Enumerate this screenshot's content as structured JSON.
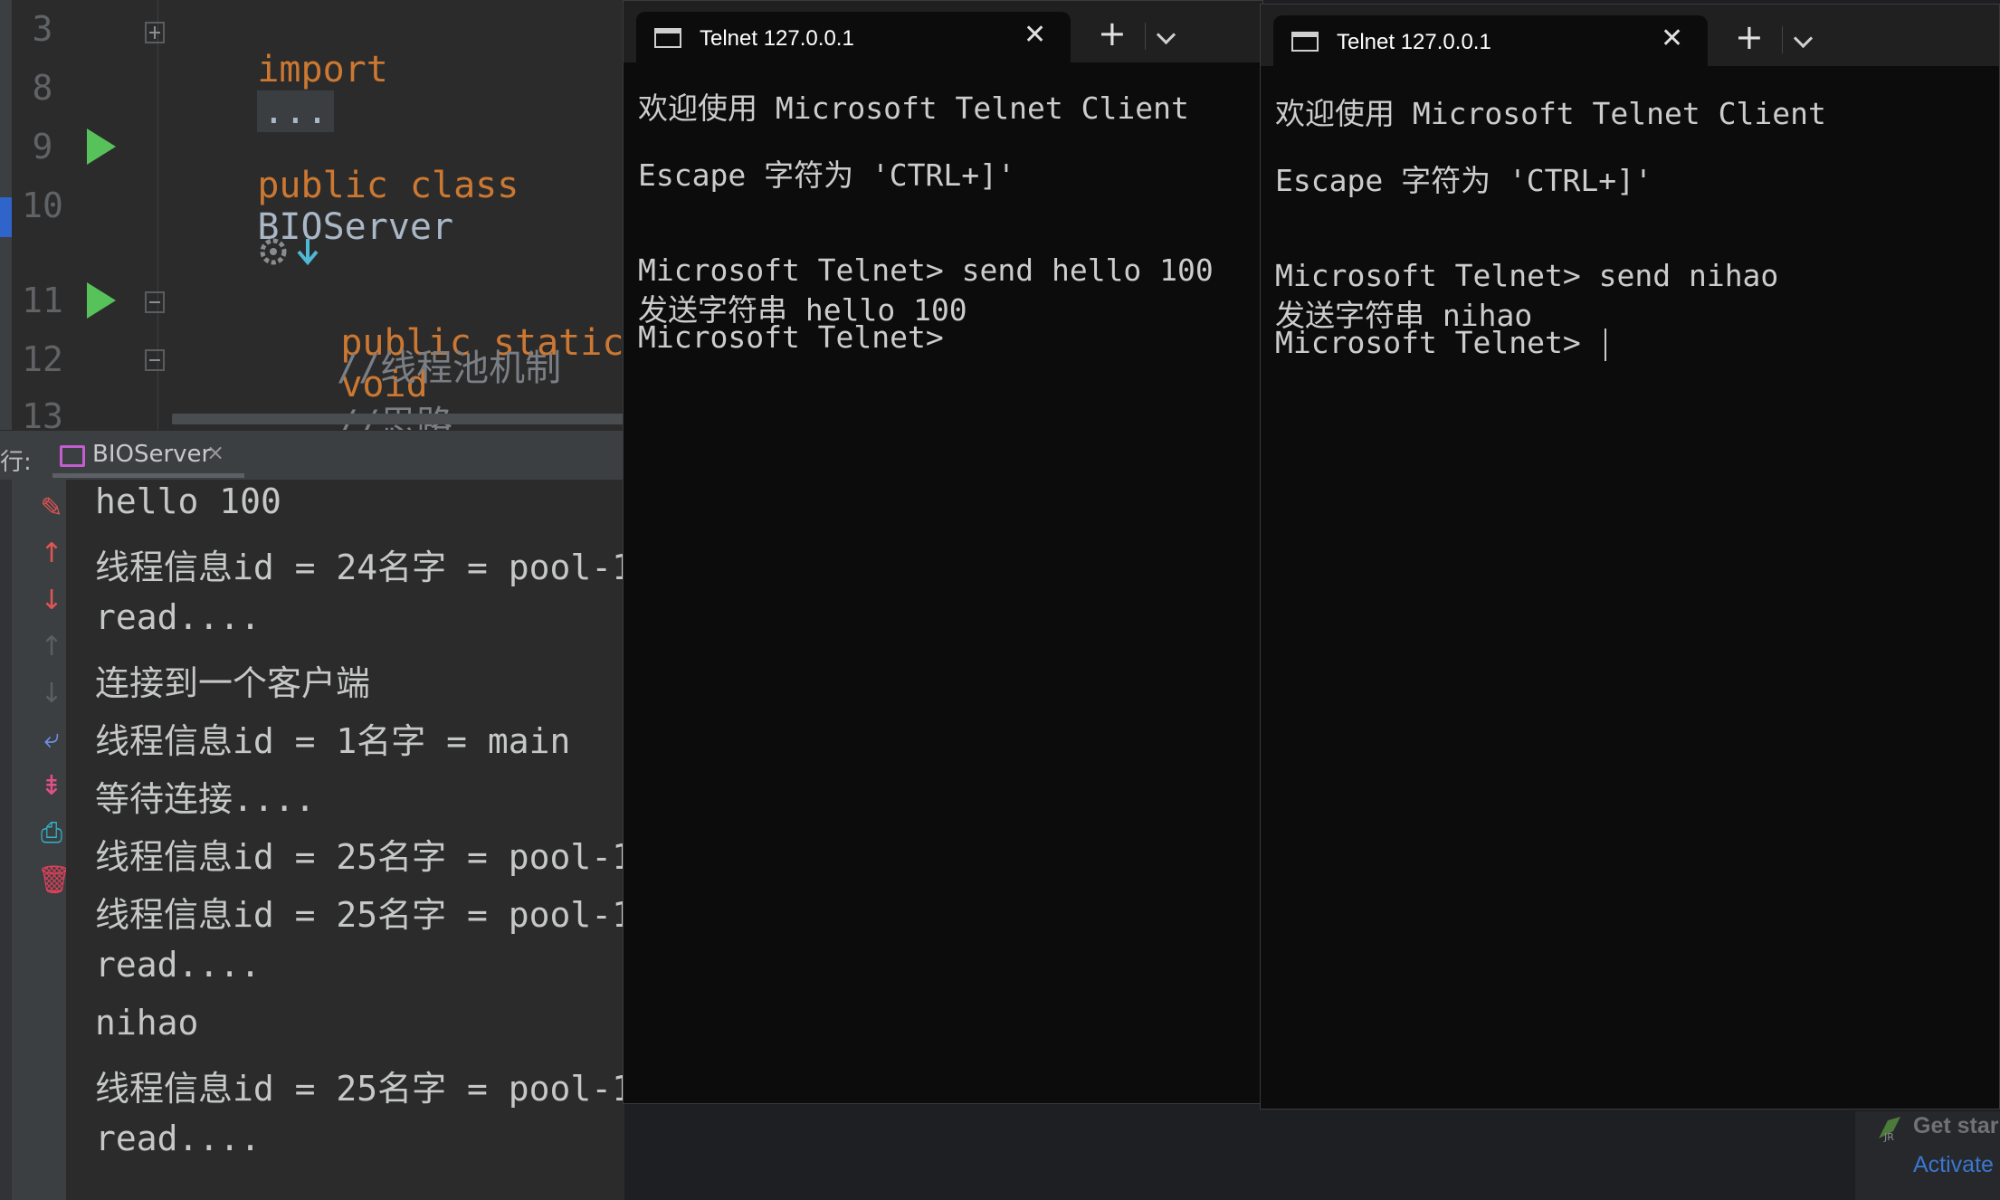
{
  "editor": {
    "line_numbers": [
      "3",
      "8",
      "9",
      "10",
      "11",
      "12",
      "13"
    ],
    "code": {
      "import_kw": "import",
      "import_dots": "...",
      "class_kw": "public class",
      "class_name": "BIOServer",
      "method_kw": "public static",
      "method_tail": "void",
      "comment1": "//线程池机制",
      "comment2": "//思路"
    }
  },
  "run_panel": {
    "label": "行:",
    "tab_label": "BIOServer",
    "tab_close": "×",
    "console_lines": [
      "hello 100",
      "线程信息id = 24名字 = pool-1",
      "read....",
      "连接到一个客户端",
      "线程信息id = 1名字 = main",
      "等待连接....",
      "线程信息id = 25名字 = pool-1",
      "线程信息id = 25名字 = pool-1",
      "read....",
      "nihao",
      "线程信息id = 25名字 = pool-1",
      "read...."
    ],
    "toolbar_icons": [
      "edit-icon",
      "scroll-up-icon",
      "scroll-down-icon",
      "up-arrow-icon",
      "down-arrow-icon",
      "soft-wrap-icon",
      "scroll-to-end-icon",
      "print-icon",
      "trash-icon"
    ]
  },
  "telnet_left": {
    "tab_title": "Telnet 127.0.0.1",
    "close": "✕",
    "new_tab": "+",
    "lines": [
      "欢迎使用 Microsoft Telnet Client",
      "Escape 字符为 'CTRL+]'",
      "Microsoft Telnet> send hello 100",
      "发送字符串 hello 100",
      "Microsoft Telnet>"
    ]
  },
  "telnet_right": {
    "tab_title": "Telnet 127.0.0.1",
    "close": "✕",
    "new_tab": "+",
    "lines": [
      "欢迎使用 Microsoft Telnet Client",
      "Escape 字符为 'CTRL+]'",
      "Microsoft Telnet> send nihao",
      "发送字符串 nihao",
      "Microsoft Telnet> "
    ]
  },
  "watermark": {
    "line1": "Get star",
    "line2": "Activate"
  },
  "colors": {
    "keyword": "#cc7832",
    "run_green": "#58c25a",
    "terminal_bg": "#0c0c0c"
  }
}
